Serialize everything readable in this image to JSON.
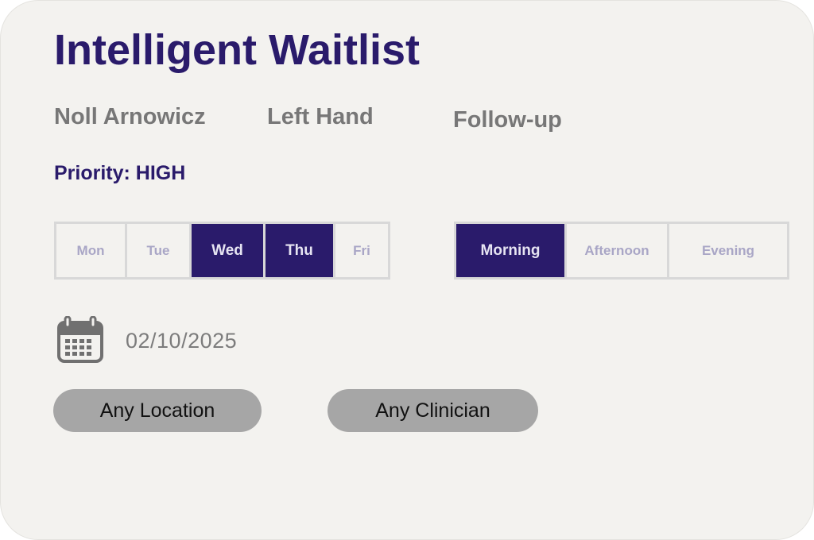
{
  "title": "Intelligent Waitlist",
  "patient": {
    "name": "Noll Arnowicz",
    "body_part": "Left Hand",
    "visit_type": "Follow-up"
  },
  "priority": "Priority: HIGH",
  "days": [
    {
      "label": "Mon",
      "selected": false
    },
    {
      "label": "Tue",
      "selected": false
    },
    {
      "label": "Wed",
      "selected": true
    },
    {
      "label": "Thu",
      "selected": true
    },
    {
      "label": "Fri",
      "selected": false
    }
  ],
  "times": [
    {
      "label": "Morning",
      "selected": true
    },
    {
      "label": "Afternoon",
      "selected": false
    },
    {
      "label": "Evening",
      "selected": false
    }
  ],
  "date": {
    "icon": "calendar-icon",
    "value": "02/10/2025"
  },
  "filters": {
    "location_label": "Any Location",
    "clinician_label": "Any Clinician"
  },
  "colors": {
    "accent": "#2a1b6b",
    "background": "#f3f2ef",
    "pill": "#a6a6a6",
    "muted_text": "#777777",
    "unselected_option": "#a9a6c6"
  }
}
